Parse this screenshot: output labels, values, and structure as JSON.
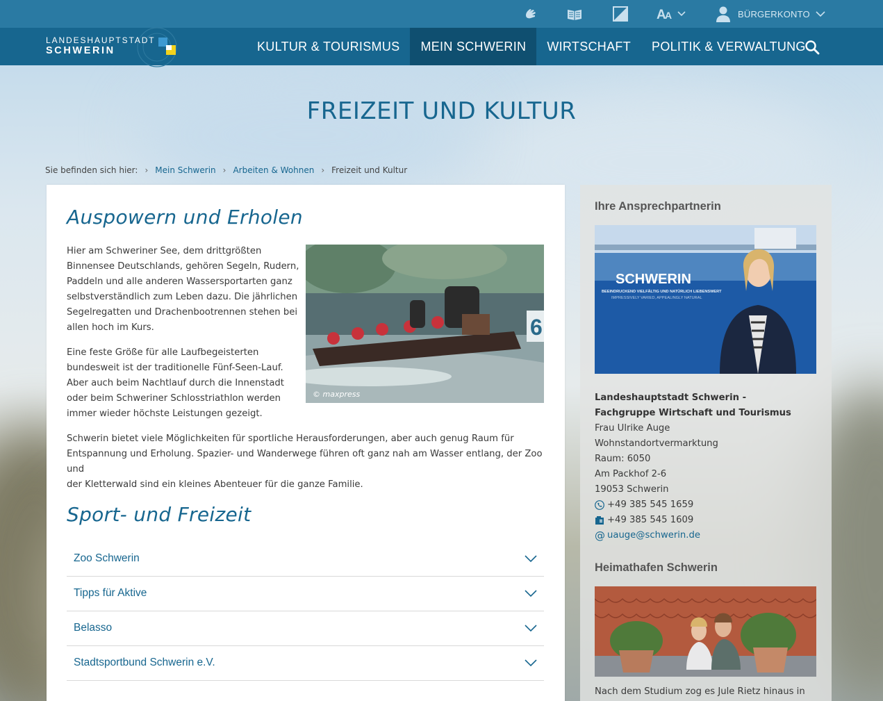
{
  "topbar": {
    "icons": [
      "sign-language-icon",
      "easy-reading-icon",
      "contrast-icon",
      "font-size-icon"
    ],
    "account_label": "BÜRGERKONTO"
  },
  "logo": {
    "line1": "LANDESHAUPTSTADT",
    "line2": "SCHWERIN"
  },
  "nav": {
    "items": [
      {
        "label": "KULTUR & TOURISMUS"
      },
      {
        "label": "MEIN SCHWERIN"
      },
      {
        "label": "WIRTSCHAFT"
      },
      {
        "label": "POLITIK & VERWALTUNG"
      }
    ],
    "active": "MEIN SCHWERIN"
  },
  "page": {
    "title": "FREIZEIT UND KULTUR"
  },
  "breadcrumb": {
    "prefix": "Sie befinden sich hier:",
    "items": [
      "Mein Schwerin",
      "Arbeiten & Wohnen",
      "Freizeit und Kultur"
    ]
  },
  "main": {
    "heading1": "Auspowern und Erholen",
    "p1": [
      "Hier am Schweriner See, dem drittgrößten",
      "Binnensee Deutschlands, gehören Segeln, Rudern,",
      "Paddeln und alle anderen Wassersportarten ganz",
      "selbstverständlich zum Leben dazu. Die jährlichen",
      "Segelregatten und Drachenbootrennen stehen bei",
      "allen hoch im Kurs."
    ],
    "p2": [
      "Eine feste Größe für alle Laufbegeisterten",
      "bundesweit ist der traditionelle Fünf-Seen-Lauf.",
      "Aber auch beim Nachtlauf durch die Innenstadt",
      "oder beim Schweriner Schlosstriathlon werden",
      "immer wieder höchste Leistungen gezeigt."
    ],
    "p3": [
      "Schwerin bietet viele Möglichkeiten für sportliche Herausforderungen, aber auch genug Raum für",
      "Entspannung und Erholung. Spazier- und Wanderwege führen oft ganz nah am Wasser entlang, der Zoo und",
      "der Kletterwald sind ein kleines Abenteuer für die ganze Familie."
    ],
    "photo_credit": "© maxpress",
    "photo_number": "6",
    "heading2": "Sport- und Freizeit",
    "accordion": [
      "Zoo Schwerin",
      "Tipps für Aktive",
      "Belasso",
      "Stadtsportbund Schwerin e.V."
    ]
  },
  "sidebar": {
    "contact_heading": "Ihre Ansprechpartnerin",
    "banner_title": "SCHWERIN",
    "banner_sub1": "BEEINDRUCKEND VIELFÄLTIG UND NATÜRLICH LIEBENSWERT",
    "banner_sub2": "IMPRESSIVELY VARIED, APPEALINGLY NATURAL",
    "org_line1": "Landeshauptstadt Schwerin -",
    "org_line2": "Fachgruppe Wirtschaft und Tourismus",
    "name": "Frau Ulrike Auge",
    "dept": "Wohnstandortvermarktung",
    "room": "Raum: 6050",
    "street": "Am Packhof 2-6",
    "city": "19053 Schwerin",
    "phone": "+49 385 545 1659",
    "fax": "+49 385 545 1609",
    "email": "uauge@schwerin.de",
    "heimathafen_heading": "Heimathafen Schwerin",
    "teaser": "Nach dem Studium zog es Jule Rietz hinaus in"
  },
  "colors": {
    "topbar": "#2a7aa3",
    "nav": "#17668f",
    "nav_active": "#0f4f70",
    "accent": "#17668f"
  }
}
